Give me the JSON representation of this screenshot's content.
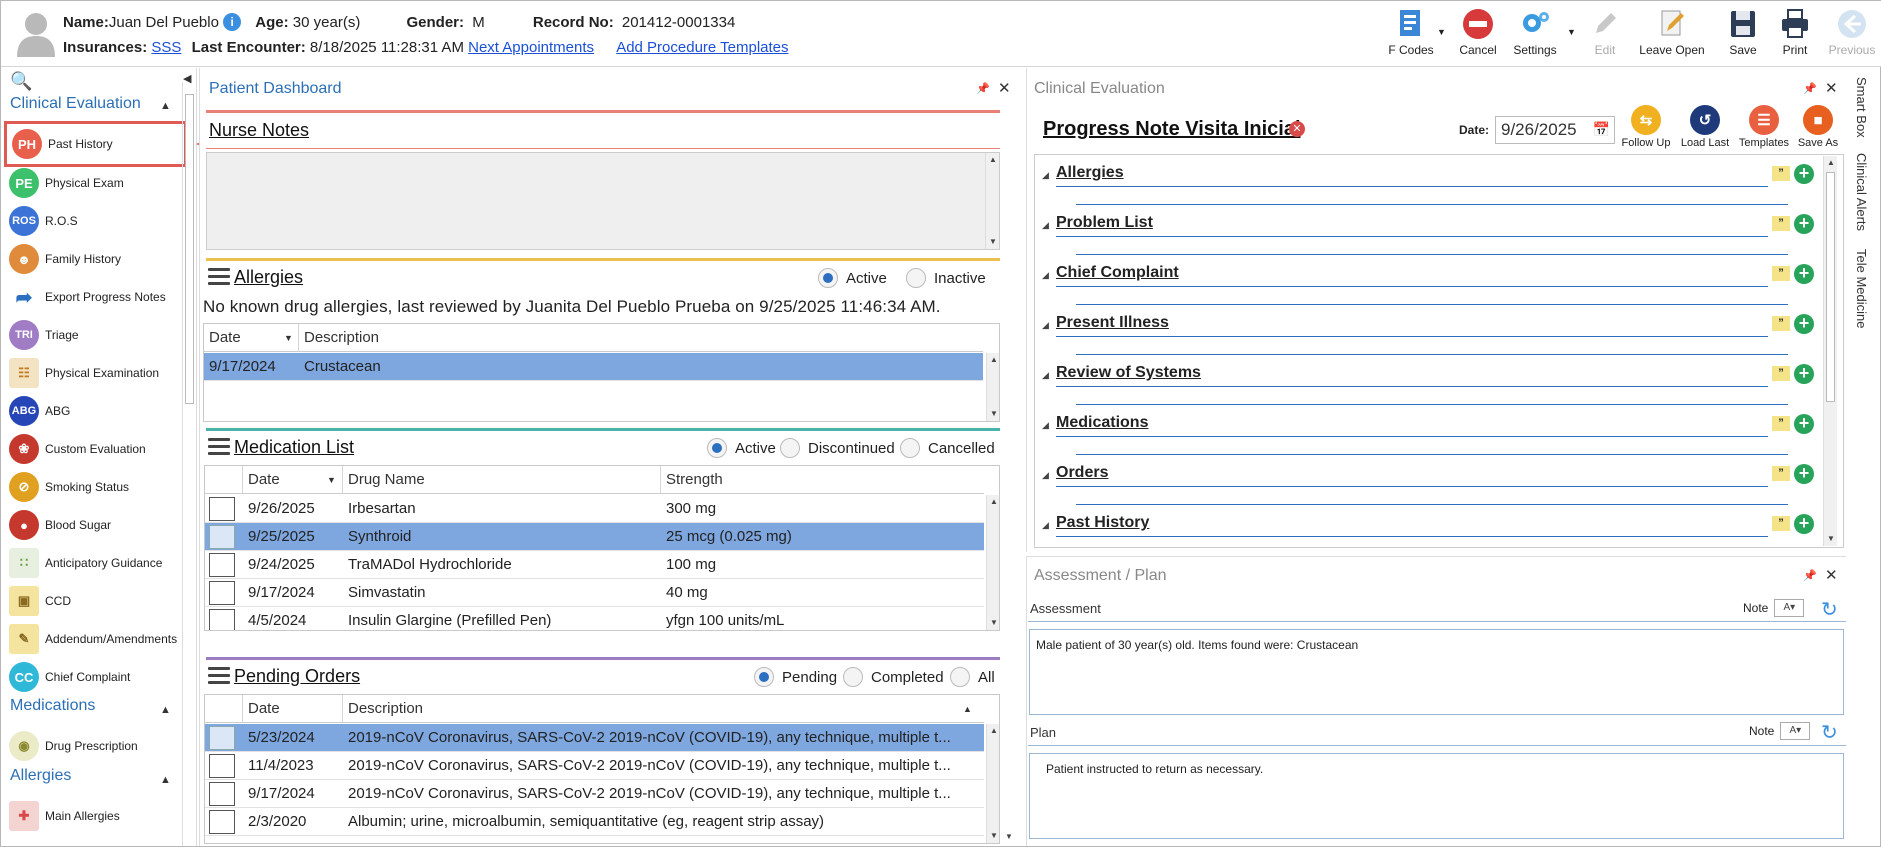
{
  "header": {
    "name_label": "Name:",
    "name": "Juan Del Pueblo",
    "age_label": "Age:",
    "age": "30 year(s)",
    "gender_label": "Gender:",
    "gender": "M",
    "record_label": "Record No:",
    "record": "201412-0001334",
    "insurances_label": "Insurances:",
    "insurance": "SSS",
    "last_encounter_label": "Last Encounter:",
    "last_encounter": "8/18/2025 11:28:31 AM",
    "next_appointments": "Next Appointments",
    "add_procedure_templates": "Add Procedure Templates"
  },
  "toolbar": {
    "f_codes": "F Codes",
    "cancel": "Cancel",
    "settings": "Settings",
    "edit": "Edit",
    "leave_open": "Leave Open",
    "save": "Save",
    "print": "Print",
    "previous": "Previous"
  },
  "sidebar": {
    "sections": [
      {
        "title": "Clinical Evaluation"
      },
      {
        "title": "Medications"
      },
      {
        "title": "Allergies"
      }
    ],
    "items": [
      {
        "label": "Past History",
        "icon": "PH",
        "color": "#e8604c"
      },
      {
        "label": "Physical Exam",
        "icon": "PE",
        "color": "#3cc06c"
      },
      {
        "label": "R.O.S",
        "icon": "ROS",
        "color": "#3b73d6"
      },
      {
        "label": "Family History",
        "icon": "family-icon",
        "color": "#e08a3c"
      },
      {
        "label": "Export Progress Notes",
        "icon": "export-icon",
        "color": "#2c6fc0"
      },
      {
        "label": "Triage",
        "icon": "TRI",
        "color": "#a07cc4"
      },
      {
        "label": "Physical Examination",
        "icon": "clipboard-icon",
        "color": "#d89a3a"
      },
      {
        "label": "ABG",
        "icon": "ABG",
        "color": "#2646b8"
      },
      {
        "label": "Custom Evaluation",
        "icon": "stethoscope-icon",
        "color": "#c4382e"
      },
      {
        "label": "Smoking Status",
        "icon": "no-smoking-icon",
        "color": "#e0a020"
      },
      {
        "label": "Blood Sugar",
        "icon": "blood-drop-icon",
        "color": "#c4382e"
      },
      {
        "label": "Anticipatory Guidance",
        "icon": "abacus-icon",
        "color": "#6a9a3a"
      },
      {
        "label": "CCD",
        "icon": "id-card-icon",
        "color": "#e0b040"
      },
      {
        "label": "Addendum/Amendments",
        "icon": "document-edit-icon",
        "color": "#e0b040"
      },
      {
        "label": "Chief Complaint",
        "icon": "CC",
        "color": "#30b8d8"
      },
      {
        "label": "Drug Prescription",
        "icon": "pill-icon",
        "color": "#c8c070"
      },
      {
        "label": "Main Allergies",
        "icon": "medical-kit-icon",
        "color": "#d84848"
      }
    ]
  },
  "dashboard": {
    "title": "Patient Dashboard",
    "nurse_notes": "Nurse Notes",
    "allergies": {
      "title": "Allergies",
      "filter_active": "Active",
      "filter_inactive": "Inactive",
      "summary": "No known drug allergies, last reviewed by Juanita Del Pueblo Prueba on 9/25/2025 11:46:34 AM.",
      "columns": [
        "Date",
        "Description"
      ],
      "rows": [
        [
          "9/17/2024",
          "Crustacean"
        ]
      ]
    },
    "medications": {
      "title": "Medication List",
      "filter_active": "Active",
      "filter_discontinued": "Discontinued",
      "filter_cancelled": "Cancelled",
      "columns": [
        "Date",
        "Drug Name",
        "Strength"
      ],
      "rows": [
        [
          "9/26/2025",
          "Irbesartan",
          "300 mg"
        ],
        [
          "9/25/2025",
          "Synthroid",
          "25 mcg (0.025 mg)"
        ],
        [
          "9/24/2025",
          "TraMADol Hydrochloride",
          "100 mg"
        ],
        [
          "9/17/2024",
          "Simvastatin",
          "40 mg"
        ],
        [
          "4/5/2024",
          "Insulin Glargine (Prefilled Pen)",
          "yfgn 100 units/mL"
        ]
      ]
    },
    "orders": {
      "title": "Pending Orders",
      "filter_pending": "Pending",
      "filter_completed": "Completed",
      "filter_all": "All",
      "columns": [
        "Date",
        "Description"
      ],
      "rows": [
        [
          "5/23/2024",
          "2019-nCoV Coronavirus, SARS-CoV-2 2019-nCoV (COVID-19), any technique, multiple t..."
        ],
        [
          "11/4/2023",
          "2019-nCoV Coronavirus, SARS-CoV-2 2019-nCoV (COVID-19), any technique, multiple t..."
        ],
        [
          "9/17/2024",
          "2019-nCoV Coronavirus, SARS-CoV-2 2019-nCoV (COVID-19), any technique, multiple t..."
        ],
        [
          "2/3/2020",
          "Albumin; urine, microalbumin, semiquantitative (eg, reagent strip assay)"
        ]
      ]
    }
  },
  "clinical": {
    "title": "Clinical Evaluation",
    "note_title": "Progress Note Visita Inicial",
    "date_label": "Date:",
    "date": "9/26/2025",
    "tools": [
      "Follow Up",
      "Load Last",
      "Templates",
      "Save As"
    ],
    "sections": [
      "Allergies",
      "Problem List",
      "Chief Complaint",
      "Present Illness",
      "Review of Systems",
      "Medications",
      "Orders",
      "Past History"
    ]
  },
  "assessment": {
    "title": "Assessment / Plan",
    "assessment_label": "Assessment",
    "note_label": "Note",
    "assessment_text": "Male patient of 30 year(s) old. Items found were:  Crustacean",
    "plan_label": "Plan",
    "plan_text": "Patient instructed to return as necessary."
  },
  "side_tabs": [
    "Smart Box",
    "Clinical Alerts",
    "Tele Medicine"
  ]
}
